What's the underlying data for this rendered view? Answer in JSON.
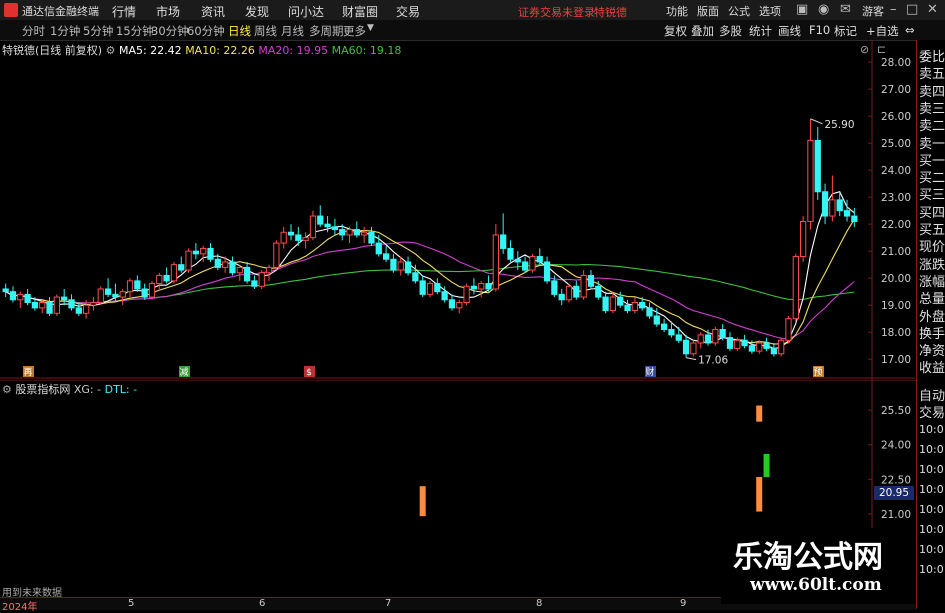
{
  "menubar": {
    "app_title": "通达信金融终端",
    "items": [
      "行情",
      "市场",
      "资讯",
      "发现",
      "问小达",
      "财富圈",
      "交易"
    ],
    "warning": "证券交易未登录",
    "stock_link": "特锐德",
    "right_items": [
      "功能",
      "版面",
      "公式",
      "选项",
      "游客"
    ]
  },
  "periodbar": {
    "periods": [
      "分时",
      "1分钟",
      "5分钟",
      "15分钟",
      "30分钟",
      "60分钟",
      "日线",
      "周线",
      "月线",
      "多周期",
      "更多"
    ],
    "active": "日线",
    "tools": [
      "复权",
      "叠加",
      "多股",
      "统计",
      "画线",
      "F10",
      "标记",
      "+自选"
    ]
  },
  "legend": {
    "stock": "特锐德(日线 前复权)",
    "ma5": "MA5: 22.42",
    "ma10": "MA10: 22.26",
    "ma20": "MA20: 19.95",
    "ma60": "MA60: 19.18"
  },
  "colors": {
    "up": "#ff4b4b",
    "down": "#34f4f4",
    "ma5": "#ffffff",
    "ma10": "#f2e060",
    "ma20": "#d040d0",
    "ma60": "#40c040",
    "grid": "#7a1a1a",
    "axis": "#7a1a1a"
  },
  "price_axis": [
    "28.00",
    "27.00",
    "26.00",
    "25.00",
    "24.00",
    "23.00",
    "22.00",
    "21.00",
    "20.00",
    "19.00",
    "18.00",
    "17.00"
  ],
  "annotations": {
    "high": "25.90",
    "low": "17.06"
  },
  "event_markers": [
    "再",
    "减",
    "$",
    "财",
    "预"
  ],
  "sub_legend": {
    "name": "股票指标网",
    "xg": "XG: -",
    "dtl": "DTL: -"
  },
  "sub_axis": [
    "25.50",
    "24.00",
    "22.50",
    "21.00"
  ],
  "price_badge": "20.95",
  "right_panel": {
    "top_labels": [
      "委比",
      "卖五",
      "卖四",
      "卖三",
      "卖二",
      "卖一",
      "买一",
      "买二",
      "买三",
      "买四",
      "买五",
      "现价",
      "涨跌",
      "涨幅",
      "总量",
      "外盘",
      "换手",
      "净资",
      "收益"
    ],
    "bottom_labels": [
      "自动",
      "交易"
    ],
    "times": [
      "10:01",
      "10:01",
      "10:01",
      "10:01",
      "10:01",
      "10:01",
      "10:01",
      "10:01"
    ]
  },
  "time_axis": {
    "year": "2024年",
    "months": [
      "5",
      "6",
      "7",
      "8",
      "9"
    ]
  },
  "bottom_status": "用到未来数据",
  "watermark": {
    "line1": "乐淘公式网",
    "line2": "www.60lt.com"
  },
  "chart_data": {
    "type": "candlestick",
    "ylim": [
      16.6,
      28.3
    ],
    "candles": [
      [
        19.6,
        19.8,
        19.3,
        19.5
      ],
      [
        19.5,
        19.7,
        19.1,
        19.2
      ],
      [
        19.2,
        19.5,
        18.9,
        19.4
      ],
      [
        19.4,
        19.6,
        19.0,
        19.1
      ],
      [
        19.1,
        19.3,
        18.8,
        18.9
      ],
      [
        18.9,
        19.2,
        18.7,
        19.1
      ],
      [
        19.1,
        19.3,
        18.6,
        18.7
      ],
      [
        18.7,
        19.4,
        18.6,
        19.3
      ],
      [
        19.3,
        19.6,
        19.0,
        19.2
      ],
      [
        19.2,
        19.4,
        18.8,
        18.9
      ],
      [
        18.9,
        19.1,
        18.6,
        18.7
      ],
      [
        18.7,
        19.2,
        18.5,
        19.0
      ],
      [
        19.0,
        19.3,
        18.8,
        19.1
      ],
      [
        19.1,
        19.7,
        19.0,
        19.6
      ],
      [
        19.6,
        20.0,
        19.3,
        19.4
      ],
      [
        19.4,
        19.8,
        19.1,
        19.3
      ],
      [
        19.3,
        19.6,
        19.0,
        19.5
      ],
      [
        19.5,
        20.0,
        19.3,
        19.9
      ],
      [
        19.9,
        20.1,
        19.5,
        19.6
      ],
      [
        19.6,
        19.8,
        19.2,
        19.3
      ],
      [
        19.3,
        19.9,
        19.2,
        19.8
      ],
      [
        19.8,
        20.2,
        19.6,
        20.1
      ],
      [
        20.1,
        20.4,
        19.8,
        19.9
      ],
      [
        19.9,
        20.6,
        19.8,
        20.5
      ],
      [
        20.5,
        20.8,
        20.2,
        20.3
      ],
      [
        20.3,
        21.1,
        20.2,
        21.0
      ],
      [
        21.0,
        21.3,
        20.7,
        20.9
      ],
      [
        20.9,
        21.2,
        20.6,
        21.1
      ],
      [
        21.1,
        21.3,
        20.6,
        20.7
      ],
      [
        20.7,
        20.9,
        20.3,
        20.4
      ],
      [
        20.4,
        20.8,
        20.2,
        20.6
      ],
      [
        20.6,
        20.8,
        20.1,
        20.2
      ],
      [
        20.2,
        20.5,
        19.9,
        20.4
      ],
      [
        20.4,
        20.6,
        19.8,
        19.9
      ],
      [
        19.9,
        20.1,
        19.6,
        19.7
      ],
      [
        19.7,
        20.3,
        19.6,
        20.2
      ],
      [
        20.2,
        20.5,
        19.9,
        20.4
      ],
      [
        20.4,
        21.4,
        20.3,
        21.3
      ],
      [
        21.3,
        21.9,
        21.1,
        21.7
      ],
      [
        21.7,
        22.0,
        21.4,
        21.6
      ],
      [
        21.6,
        21.9,
        21.2,
        21.4
      ],
      [
        21.4,
        21.7,
        21.1,
        21.5
      ],
      [
        21.5,
        22.5,
        21.4,
        22.3
      ],
      [
        22.3,
        22.7,
        21.9,
        22.0
      ],
      [
        22.0,
        22.3,
        21.7,
        21.9
      ],
      [
        21.9,
        22.2,
        21.6,
        21.8
      ],
      [
        21.8,
        22.0,
        21.4,
        21.6
      ],
      [
        21.6,
        21.9,
        21.3,
        21.8
      ],
      [
        21.8,
        22.1,
        21.5,
        21.6
      ],
      [
        21.6,
        21.9,
        21.3,
        21.7
      ],
      [
        21.7,
        21.9,
        21.2,
        21.3
      ],
      [
        21.3,
        21.6,
        20.8,
        20.9
      ],
      [
        20.9,
        21.2,
        20.6,
        20.7
      ],
      [
        20.7,
        20.9,
        20.2,
        20.3
      ],
      [
        20.3,
        20.8,
        20.1,
        20.6
      ],
      [
        20.6,
        20.8,
        20.1,
        20.2
      ],
      [
        20.2,
        20.5,
        19.8,
        19.9
      ],
      [
        19.9,
        20.1,
        19.3,
        19.4
      ],
      [
        19.4,
        19.9,
        19.3,
        19.8
      ],
      [
        19.8,
        20.0,
        19.4,
        19.5
      ],
      [
        19.5,
        19.7,
        19.1,
        19.2
      ],
      [
        19.2,
        19.4,
        18.8,
        18.9
      ],
      [
        18.9,
        19.2,
        18.7,
        19.1
      ],
      [
        19.1,
        19.8,
        19.0,
        19.7
      ],
      [
        19.7,
        20.0,
        19.4,
        19.6
      ],
      [
        19.6,
        19.9,
        19.3,
        19.8
      ],
      [
        19.8,
        20.1,
        19.5,
        19.6
      ],
      [
        19.6,
        22.0,
        19.5,
        21.6
      ],
      [
        21.6,
        22.4,
        20.9,
        21.1
      ],
      [
        21.1,
        21.4,
        20.6,
        20.7
      ],
      [
        20.7,
        21.0,
        20.3,
        20.6
      ],
      [
        20.6,
        20.8,
        20.2,
        20.3
      ],
      [
        20.3,
        20.9,
        20.2,
        20.8
      ],
      [
        20.8,
        21.1,
        20.5,
        20.6
      ],
      [
        20.6,
        20.8,
        19.8,
        19.9
      ],
      [
        19.9,
        20.1,
        19.3,
        19.4
      ],
      [
        19.4,
        19.6,
        19.0,
        19.2
      ],
      [
        19.2,
        19.8,
        19.1,
        19.7
      ],
      [
        19.7,
        19.9,
        19.2,
        19.3
      ],
      [
        19.3,
        20.3,
        19.2,
        20.1
      ],
      [
        20.1,
        20.3,
        19.6,
        19.7
      ],
      [
        19.7,
        19.9,
        19.2,
        19.3
      ],
      [
        19.3,
        19.5,
        18.7,
        18.8
      ],
      [
        18.8,
        19.5,
        18.7,
        19.3
      ],
      [
        19.3,
        19.5,
        18.9,
        19.0
      ],
      [
        19.0,
        19.2,
        18.7,
        18.8
      ],
      [
        18.8,
        19.3,
        18.7,
        19.1
      ],
      [
        19.1,
        19.3,
        18.8,
        18.9
      ],
      [
        18.9,
        19.1,
        18.5,
        18.6
      ],
      [
        18.6,
        18.9,
        18.2,
        18.3
      ],
      [
        18.3,
        18.5,
        18.0,
        18.1
      ],
      [
        18.1,
        18.4,
        17.8,
        17.9
      ],
      [
        17.9,
        18.2,
        17.6,
        17.7
      ],
      [
        17.7,
        17.9,
        17.06,
        17.2
      ],
      [
        17.2,
        17.7,
        17.1,
        17.6
      ],
      [
        17.6,
        18.0,
        17.4,
        17.9
      ],
      [
        17.9,
        18.1,
        17.5,
        17.6
      ],
      [
        17.6,
        18.2,
        17.5,
        18.1
      ],
      [
        18.1,
        18.3,
        17.7,
        17.8
      ],
      [
        17.8,
        18.0,
        17.3,
        17.4
      ],
      [
        17.4,
        17.8,
        17.3,
        17.7
      ],
      [
        17.7,
        17.9,
        17.4,
        17.5
      ],
      [
        17.5,
        17.7,
        17.2,
        17.3
      ],
      [
        17.3,
        17.7,
        17.2,
        17.6
      ],
      [
        17.6,
        17.8,
        17.3,
        17.4
      ],
      [
        17.4,
        17.6,
        17.1,
        17.2
      ],
      [
        17.2,
        17.8,
        17.1,
        17.7
      ],
      [
        17.7,
        18.6,
        17.6,
        18.5
      ],
      [
        18.5,
        20.9,
        18.4,
        20.8
      ],
      [
        20.8,
        22.3,
        20.6,
        22.1
      ],
      [
        22.1,
        25.9,
        21.8,
        25.1
      ],
      [
        25.1,
        25.6,
        22.9,
        23.2
      ],
      [
        23.2,
        23.5,
        22.0,
        22.3
      ],
      [
        22.3,
        23.8,
        22.1,
        22.9
      ],
      [
        22.9,
        23.2,
        22.3,
        22.5
      ],
      [
        22.5,
        22.9,
        22.1,
        22.3
      ],
      [
        22.3,
        22.6,
        21.9,
        22.1
      ]
    ],
    "sub_bars": [
      {
        "index": 57,
        "from": 20.9,
        "to": 22.2,
        "color": "#ff8c3c"
      },
      {
        "index": 103,
        "from": 25.7,
        "to": 25.0,
        "color": "#ff8c3c"
      },
      {
        "index": 104,
        "from": 23.6,
        "to": 22.6,
        "color": "#22cc22"
      },
      {
        "index": 103,
        "from": 22.6,
        "to": 21.1,
        "color": "#ff8c3c"
      }
    ],
    "sub_ylim": [
      20.3,
      26.2
    ]
  }
}
